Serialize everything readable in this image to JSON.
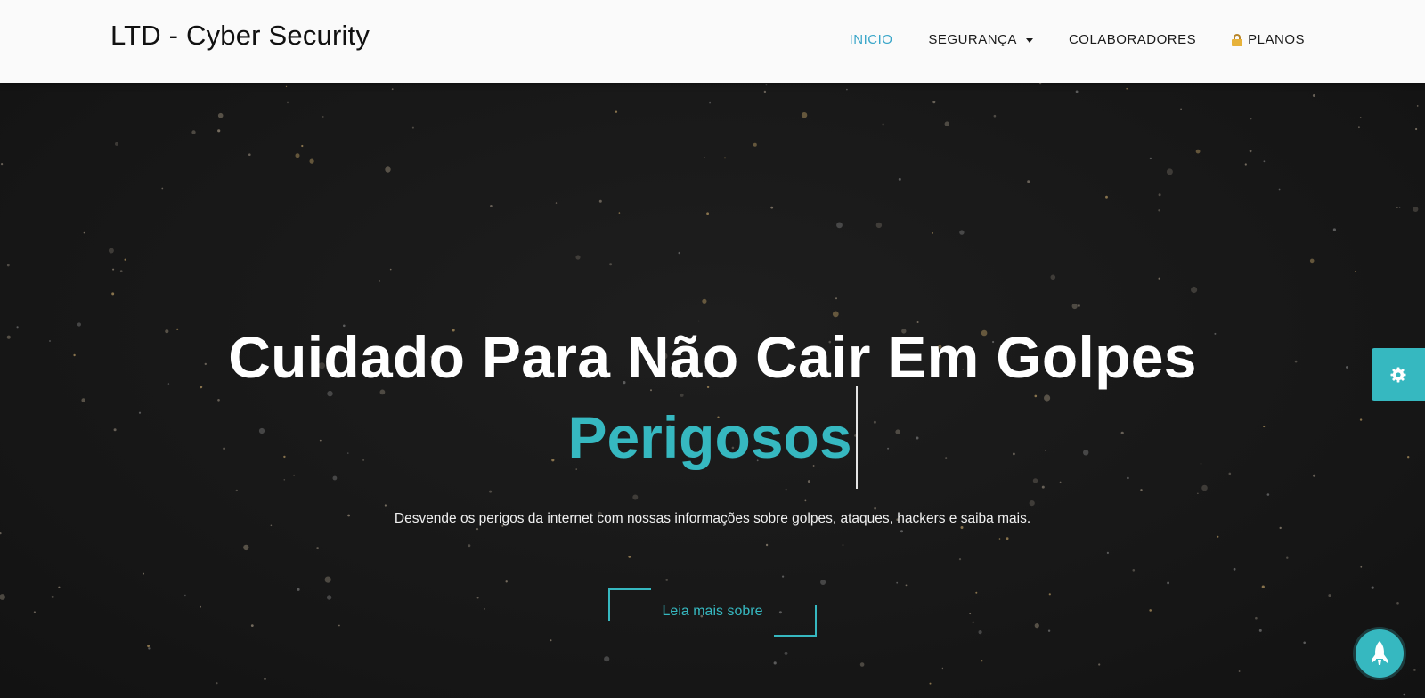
{
  "navbar": {
    "brand": "LTD - Cyber Security",
    "items": [
      {
        "label": "INICIO",
        "active": true
      },
      {
        "label": "SEGURANÇA",
        "dropdown": true
      },
      {
        "label": "COLABORADORES"
      },
      {
        "label": "PLANOS",
        "icon": "lock-icon"
      }
    ]
  },
  "hero": {
    "title": "Cuidado Para Não Cair Em Golpes",
    "typed_word": "Perigosos",
    "description": "Desvende os perigos da internet com nossas informações sobre golpes, ataques, hackers e saiba mais.",
    "button_label": "Leia mais sobre"
  },
  "widgets": {
    "settings_icon": "gear-icon",
    "scroll_top_icon": "rocket-icon"
  },
  "colors": {
    "accent": "#36b8c0",
    "active_nav": "#3aa6c9",
    "hero_background": "#181818",
    "navbar_background": "#fafafa"
  }
}
